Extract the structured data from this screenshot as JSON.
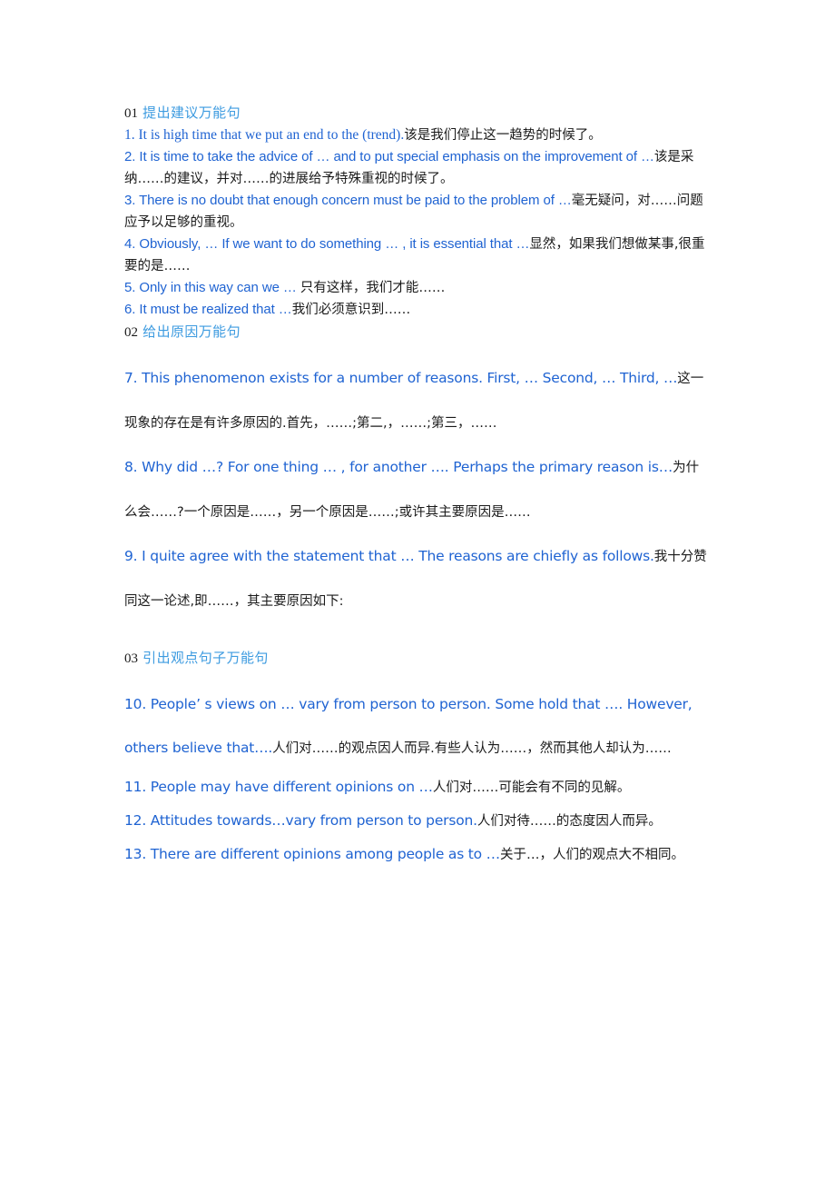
{
  "document": {
    "background_color": "#ffffff",
    "english_color": "#1f63d2",
    "chinese_color": "#1a1a1a",
    "header_number_color": "#1a1a1a",
    "header_chinese_color": "#3d9be0"
  },
  "sections": [
    {
      "number": "01",
      "title_cn": "提出建议万能句",
      "items": [
        {
          "index": "1.",
          "en": "1. It is high time that we put an end to the (trend).",
          "cn": "该是我们停止这一趋势的时候了。"
        },
        {
          "index": "2.",
          "en": "2. It is time to take the advice of … and to put special emphasis on the improvement of …",
          "cn": "该是采纳……的建议，并对……的进展给予特殊重视的时候了。"
        },
        {
          "index": "3.",
          "en": "3. There is no doubt that enough concern must be paid to the problem of …",
          "cn": "毫无疑问，对……问题应予以足够的重视。"
        },
        {
          "index": "4.",
          "en": "4. Obviously, … If we want to do something … , it is essential that …",
          "cn": "显然，如果我们想做某事,很重要的是……"
        },
        {
          "index": "5.",
          "en": "5. Only in this way can we … ",
          "cn": "只有这样，我们才能……"
        },
        {
          "index": "6.",
          "en": "6. It must be realized that …",
          "cn": "我们必须意识到……"
        }
      ]
    },
    {
      "number": "02",
      "title_cn": "给出原因万能句",
      "items": [
        {
          "index": "7.",
          "en": "7. This phenomenon exists for a number of reasons. First,  …  Second,  … Third,  …",
          "cn": "这一现象的存在是有许多原因的.首先，……;第二,，……;第三，……"
        },
        {
          "index": "8.",
          "en": "8. Why did  …? For one thing  … , for another  …. Perhaps the primary reason is…",
          "cn": "为什么会……?一个原因是……，另一个原因是……;或许其主要原因是……"
        },
        {
          "index": "9.",
          "en": "9. I quite agree with the statement that  …  The reasons are chiefly as follows.",
          "cn": "我十分赞同这一论述,即……，其主要原因如下:"
        }
      ]
    },
    {
      "number": "03",
      "title_cn": "引出观点句子万能句",
      "items": [
        {
          "index": "10.",
          "en": "10. People’ s views on  …  vary from person to person. Some hold that  …. However, others believe that….",
          "cn": "人们对……的观点因人而异.有些人认为……，然而其他人却认为……"
        },
        {
          "index": "11.",
          "en": "11. People may have different opinions on  …",
          "cn": "人们对……可能会有不同的见解。"
        },
        {
          "index": "12.",
          "en": "12. Attitudes towards…vary from person to person.",
          "cn": "人们对待……的态度因人而异。"
        },
        {
          "index": "13.",
          "en": "13. There are different opinions among people as to  …",
          "cn": "关于…，人们的观点大不相同。"
        }
      ]
    }
  ]
}
